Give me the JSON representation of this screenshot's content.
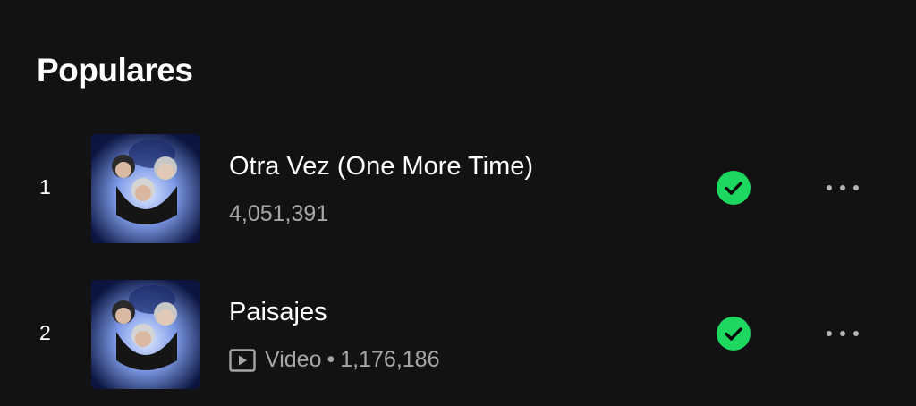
{
  "section": {
    "title": "Populares"
  },
  "colors": {
    "background": "#121212",
    "accent": "#1ed760",
    "secondary_text": "#a7a7a7"
  },
  "tracks": [
    {
      "rank": "1",
      "title": "Otra Vez (One More Time)",
      "plays": "4,051,391",
      "saved_icon": "check-circle-icon",
      "more_icon": "more-options-icon"
    },
    {
      "rank": "2",
      "title": "Paisajes",
      "video_label": "Video",
      "separator": "•",
      "plays": "1,176,186",
      "saved_icon": "check-circle-icon",
      "more_icon": "more-options-icon"
    }
  ]
}
